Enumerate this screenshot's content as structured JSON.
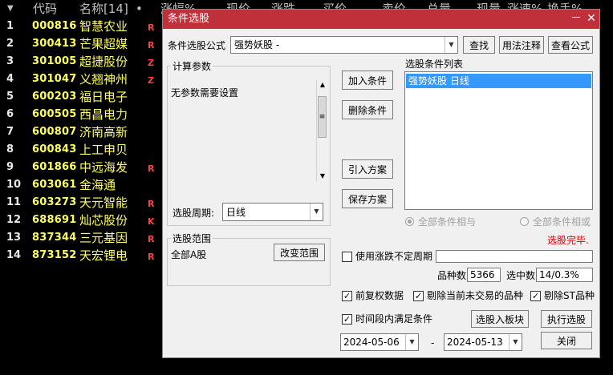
{
  "header": {
    "arrow": "▼",
    "code": "代码",
    "name": "名称[14]",
    "dot": "•",
    "cols": [
      "涨幅%",
      "现价",
      "涨跌",
      "买价",
      "卖价",
      "总量",
      "现量",
      "涨速%",
      "换手%"
    ]
  },
  "rows": [
    {
      "idx": "1",
      "code": "000816",
      "name": "智慧农业",
      "flag": "R"
    },
    {
      "idx": "2",
      "code": "300413",
      "name": "芒果超媒",
      "flag": "R"
    },
    {
      "idx": "3",
      "code": "301005",
      "name": "超捷股份",
      "flag": "Z"
    },
    {
      "idx": "4",
      "code": "301047",
      "name": "义翘神州",
      "flag": "Z"
    },
    {
      "idx": "5",
      "code": "600203",
      "name": "福日电子",
      "flag": ""
    },
    {
      "idx": "6",
      "code": "600505",
      "name": "西昌电力",
      "flag": ""
    },
    {
      "idx": "7",
      "code": "600807",
      "name": "济南高新",
      "flag": ""
    },
    {
      "idx": "8",
      "code": "600843",
      "name": "上工申贝",
      "flag": ""
    },
    {
      "idx": "9",
      "code": "601866",
      "name": "中远海发",
      "flag": "R"
    },
    {
      "idx": "10",
      "code": "603061",
      "name": "金海通",
      "flag": ""
    },
    {
      "idx": "11",
      "code": "603273",
      "name": "天元智能",
      "flag": "R"
    },
    {
      "idx": "12",
      "code": "688691",
      "name": "灿芯股份",
      "flag": "K"
    },
    {
      "idx": "13",
      "code": "837344",
      "name": "三元基因",
      "flag": "R"
    },
    {
      "idx": "14",
      "code": "873152",
      "name": "天宏锂电",
      "flag": "R"
    }
  ],
  "dialog": {
    "title": "条件选股",
    "minimize": "－",
    "close": "✕",
    "formula_label": "条件选股公式",
    "formula_value": "强势妖股      -",
    "find": "查找",
    "usage": "用法注释",
    "view_formula": "查看公式",
    "params_group": "计算参数",
    "params_text": "无参数需要设置",
    "add_condition": "加入条件",
    "delete_condition": "删除条件",
    "import_plan": "引入方案",
    "save_plan": "保存方案",
    "cond_list_label": "选股条件列表",
    "cond_items": [
      "强势妖股  日线"
    ],
    "period_label": "选股周期:",
    "period_value": "日线",
    "and_label": "全部条件相与",
    "or_label": "全部条件相或",
    "status": "选股完毕.",
    "range_group": "选股范围",
    "range_value": "全部A股",
    "change_range": "改变范围",
    "use_period_label": "使用涨跌不定周期",
    "count_label": "品种数",
    "count_value": "5366",
    "selected_label": "选中数",
    "selected_value": "14/0.3%",
    "opt_prefq": "前复权数据",
    "opt_exclude_untraded": "剔除当前未交易的品种",
    "opt_exclude_st": "剔除ST品种",
    "opt_time_range": "时间段内满足条件",
    "to_block": "选股入板块",
    "execute": "执行选股",
    "date_from": "2024-05-06",
    "date_sep": "-",
    "date_to": "2024-05-13",
    "close_btn": "关闭",
    "status_color": "#e00000",
    "accent": "#c0303a"
  }
}
